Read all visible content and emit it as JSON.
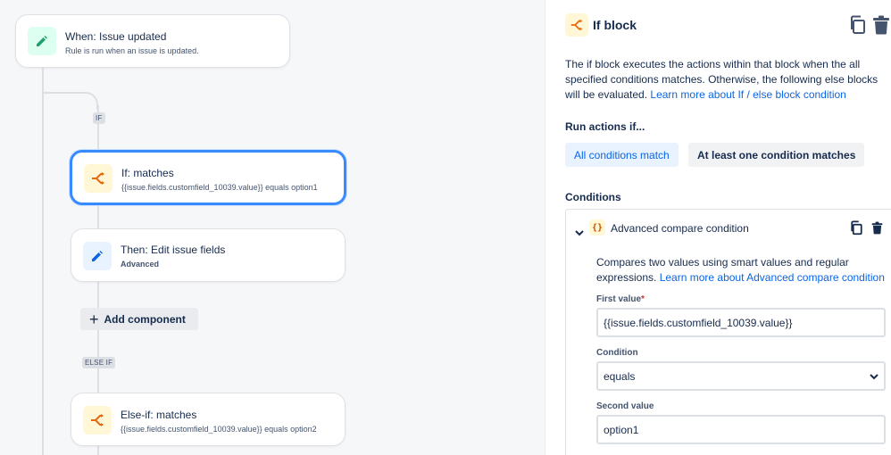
{
  "trigger": {
    "title": "When: Issue updated",
    "subtitle": "Rule is run when an issue is updated."
  },
  "branch_if_tag": "IF",
  "branch_elseif_tag": "ELSE IF",
  "if_card": {
    "title": "If: matches",
    "subtitle": "{{issue.fields.customfield_10039.value}} equals option1"
  },
  "then_card": {
    "title": "Then: Edit issue fields",
    "subtitle": "Advanced"
  },
  "add_component": "Add component",
  "elseif_card": {
    "title": "Else-if: matches",
    "subtitle": "{{issue.fields.customfield_10039.value}} equals option2"
  },
  "panel": {
    "title": "If block",
    "description": "The if block executes the actions within that block when the all specified conditions matches. Otherwise, the following else blocks will be evaluated. ",
    "description_link": "Learn more about If / else block condition",
    "run_actions_label": "Run actions if...",
    "option_all": "All conditions match",
    "option_any": "At least one condition matches",
    "conditions_label": "Conditions",
    "condition": {
      "title": "Advanced compare condition",
      "description": "Compares two values using smart values and regular expressions. ",
      "description_link": "Learn more about Advanced compare condition",
      "first_value_label": "First value",
      "required_mark": "*",
      "first_value": "{{issue.fields.customfield_10039.value}}",
      "condition_label": "Condition",
      "condition_value": "equals",
      "second_value_label": "Second value",
      "second_value": "option1"
    }
  },
  "colors": {
    "accent": "#0c66e4",
    "selected_border": "#388bff",
    "trigger_icon_bg": "#dcfff1",
    "trigger_icon": "#22a06b",
    "condition_icon_bg": "#fff7d6",
    "condition_icon": "#e56910",
    "action_icon_bg": "#e9f2ff",
    "action_icon": "#0c66e4"
  },
  "icons": {
    "trigger": "pencil-icon",
    "condition": "branch-icon",
    "action": "pencil-icon",
    "copy": "copy-icon",
    "delete": "trash-icon",
    "expand": "chevron-down-icon",
    "smart_value": "curly-braces-icon",
    "add": "plus-icon",
    "dropdown": "chevron-down-icon"
  }
}
